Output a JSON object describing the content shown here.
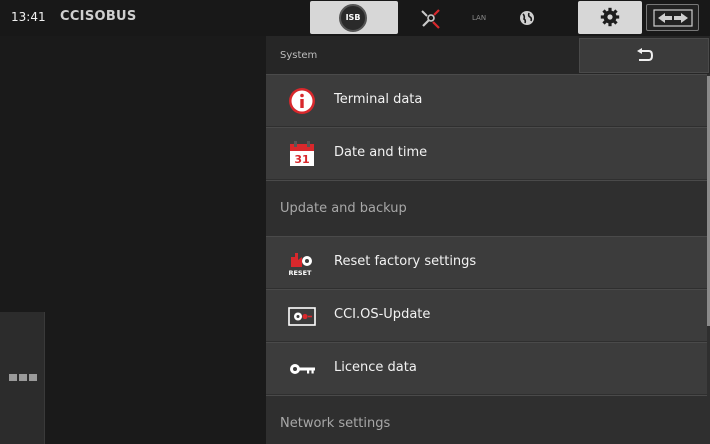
{
  "status_bar": {
    "time": "13:41",
    "brand": "CCISOBUS",
    "isb_label": "ISB",
    "lan_label": "LAN"
  },
  "panel": {
    "title": "System",
    "items": [
      {
        "label": "Terminal data",
        "icon": "info-icon"
      },
      {
        "label": "Date and time",
        "icon": "calendar-icon"
      },
      {
        "label": "Reset factory settings",
        "icon": "reset-factory-icon",
        "icon_text": "RESET"
      },
      {
        "label": "CCI.OS-Update",
        "icon": "update-icon"
      },
      {
        "label": "Licence data",
        "icon": "key-icon"
      }
    ],
    "sections": [
      {
        "label": "Update and backup"
      },
      {
        "label": "Network settings"
      }
    ],
    "calendar_day": "31"
  },
  "colors": {
    "accent_red": "#d8282c",
    "background": "#1a1a1a",
    "panel": "#2f2f2f",
    "item": "#3c3c3c"
  }
}
